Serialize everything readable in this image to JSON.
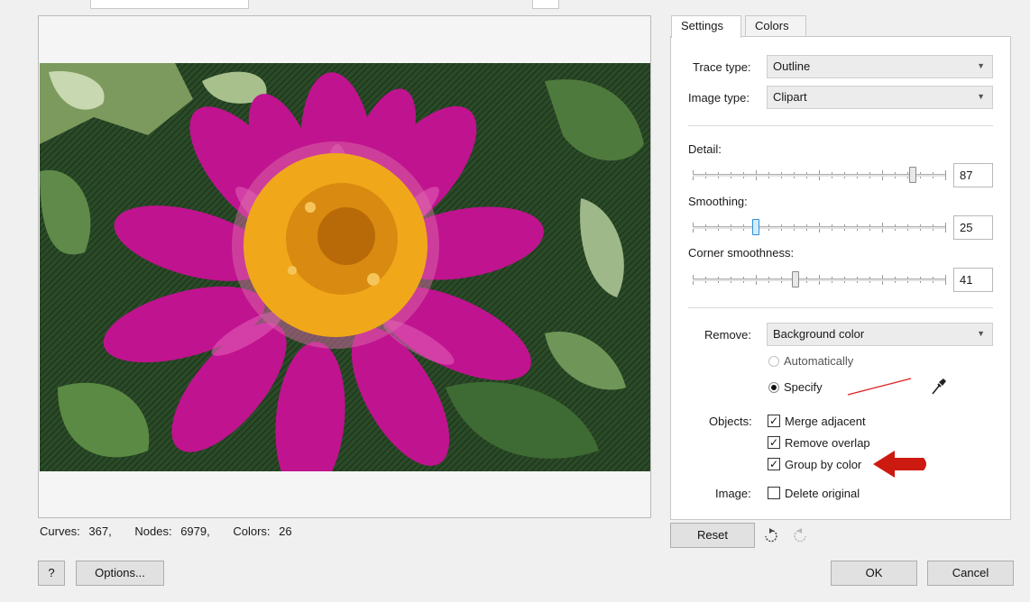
{
  "preview": {
    "stats": {
      "curves_label": "Curves:",
      "curves_value": "367,",
      "nodes_label": "Nodes:",
      "nodes_value": "6979,",
      "colors_label": "Colors:",
      "colors_value": "26"
    }
  },
  "tabs": [
    {
      "label": "Settings",
      "active": true
    },
    {
      "label": "Colors",
      "active": false
    }
  ],
  "settings": {
    "trace_type_label": "Trace type:",
    "trace_type_value": "Outline",
    "image_type_label": "Image type:",
    "image_type_value": "Clipart",
    "detail_label": "Detail:",
    "detail_value": "87",
    "smoothing_label": "Smoothing:",
    "smoothing_value": "25",
    "corner_label": "Corner smoothness:",
    "corner_value": "41",
    "remove_label": "Remove:",
    "remove_value": "Background color",
    "auto_label": "Automatically",
    "specify_label": "Specify",
    "objects_label": "Objects:",
    "merge_label": "Merge adjacent",
    "overlap_label": "Remove overlap",
    "group_label": "Group by color",
    "image_label": "Image:",
    "delete_label": "Delete original",
    "merge_checked": true,
    "overlap_checked": true,
    "group_checked": true,
    "delete_checked": false,
    "specify_color": "#e02020"
  },
  "buttons": {
    "reset": "Reset",
    "help": "?",
    "options": "Options...",
    "ok": "OK",
    "cancel": "Cancel"
  },
  "colors": {
    "accent_arrow": "#cc1a10",
    "petal": "#c0138f",
    "center": "#f0a81a",
    "foliage": "#2f5a2a"
  }
}
